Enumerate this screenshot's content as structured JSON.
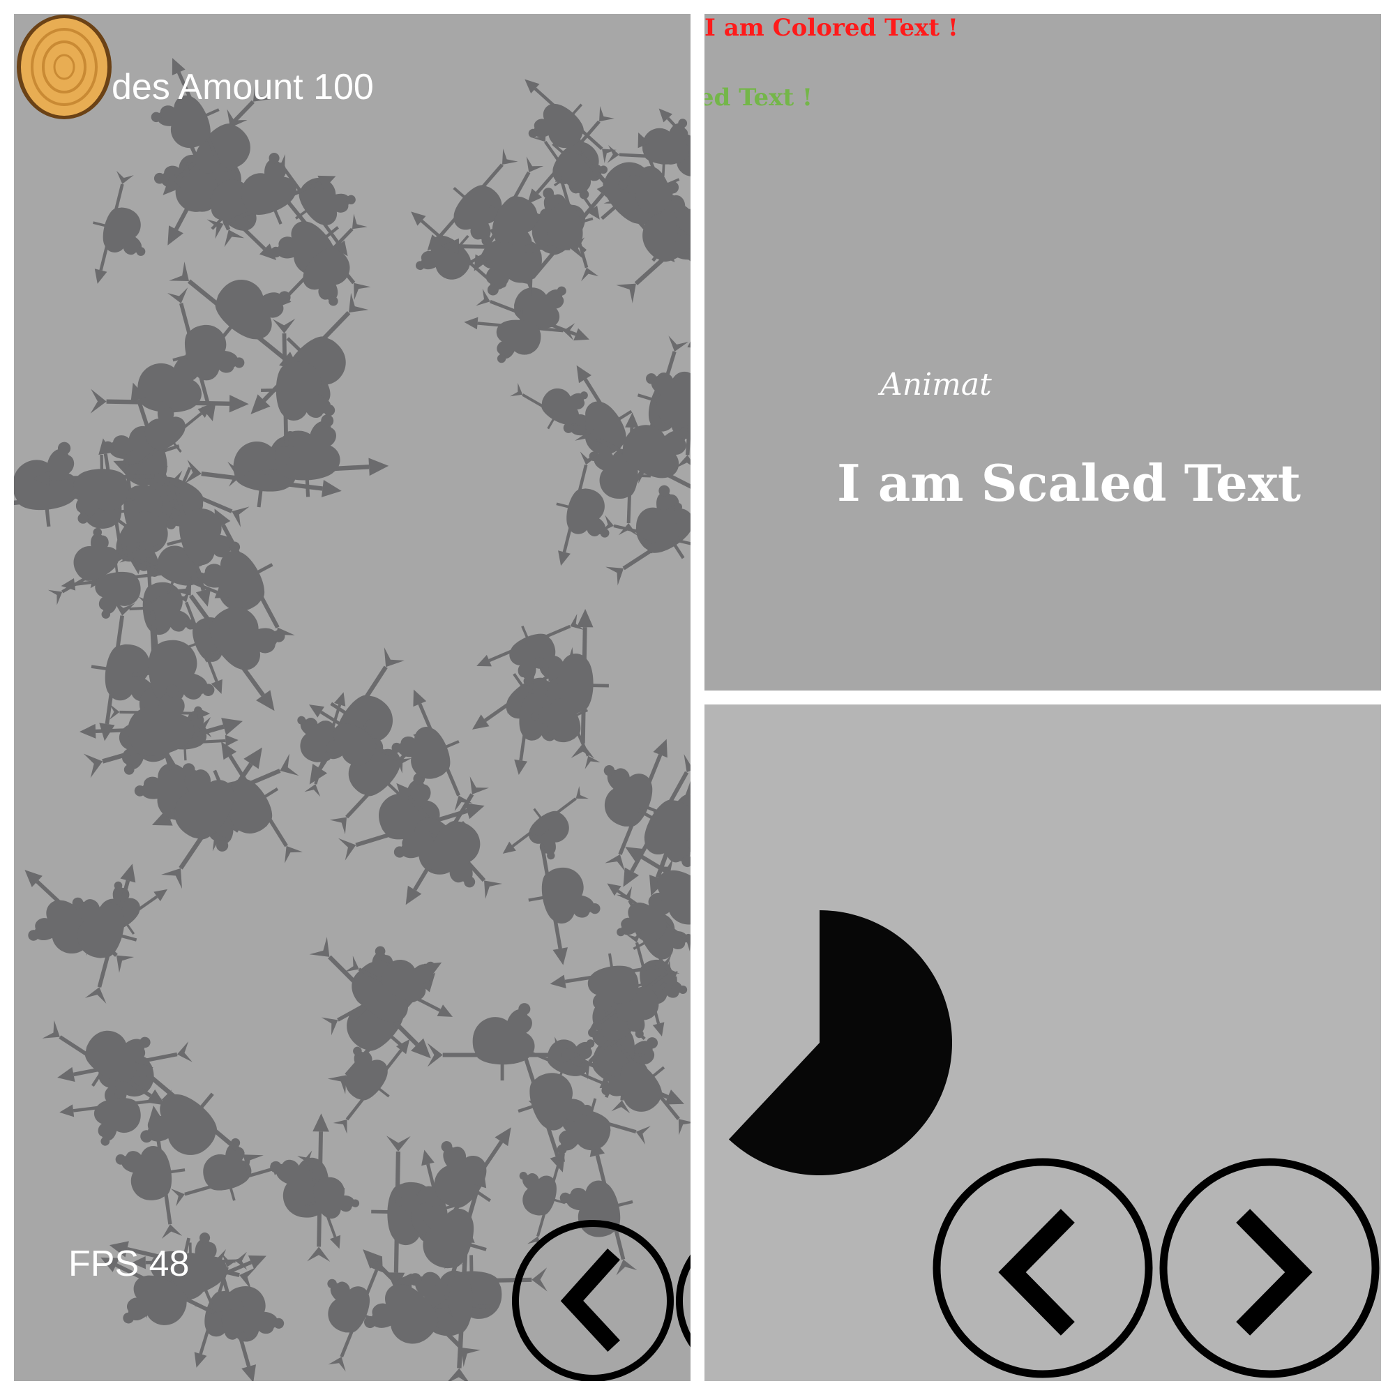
{
  "left_panel": {
    "hud": {
      "nodes_amount_text": "des Amount  100",
      "fps_text": "FPS 48"
    },
    "sprite_color": "#6b6b6d",
    "badge_icon": "wood-slice-icon",
    "back_button_icon": "chevron-left-icon"
  },
  "top_right_panel": {
    "colored_text_red": "I am Colored Text !",
    "colored_text_green": "red Text !",
    "animated_text": "Animat",
    "scaled_text": "I am Scaled Text",
    "colors": {
      "red": "#ff1a1a",
      "green": "#74b649"
    }
  },
  "bottom_right_panel": {
    "progress_shape": "black-radial-progress",
    "progress_fraction": 0.62,
    "prev_button_icon": "chevron-left-icon",
    "next_button_icon": "chevron-right-icon"
  }
}
